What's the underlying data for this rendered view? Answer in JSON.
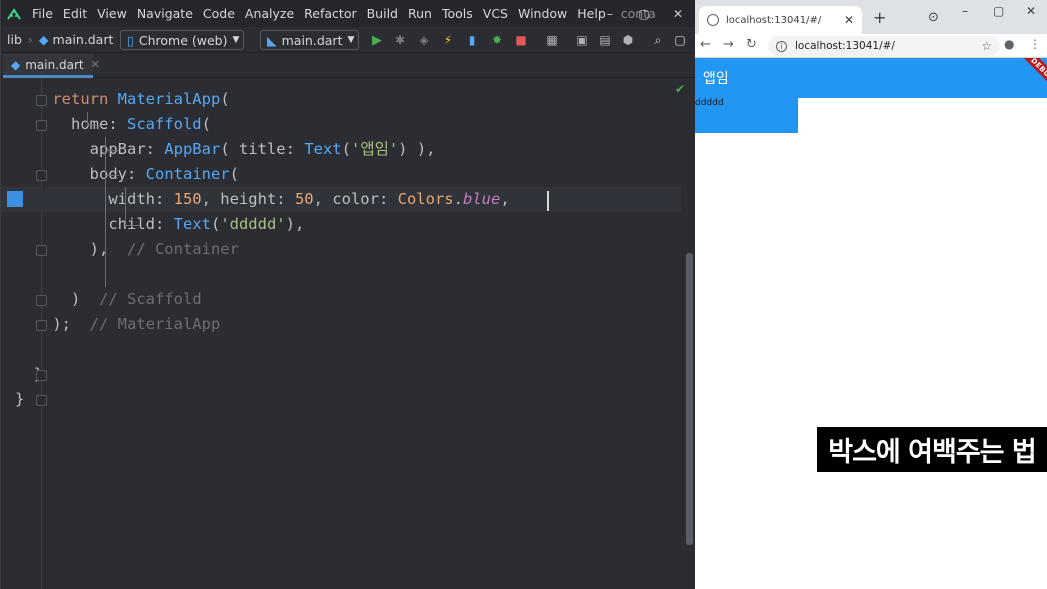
{
  "ide": {
    "menu": [
      "File",
      "Edit",
      "View",
      "Navigate",
      "Code",
      "Analyze",
      "Refactor",
      "Build",
      "Run",
      "Tools",
      "VCS",
      "Window",
      "Help"
    ],
    "project_name": "contact",
    "window_controls": [
      "–",
      "▢",
      "✕"
    ],
    "toolbar": {
      "crumb_lib": "lib",
      "crumb_file": "main.dart",
      "device": "Chrome (web)",
      "run_config": "main.dart"
    },
    "tab": {
      "label": "main.dart"
    },
    "check_mark": "✔"
  },
  "code": {
    "lines": [
      [
        {
          "t": "    "
        },
        {
          "t": "return ",
          "c": "kw"
        },
        {
          "t": "MaterialApp",
          "c": "cls"
        },
        {
          "t": "("
        }
      ],
      [
        {
          "t": "      home: "
        },
        {
          "t": "Scaffold",
          "c": "cls"
        },
        {
          "t": "("
        }
      ],
      [
        {
          "t": "        appBar: "
        },
        {
          "t": "AppBar",
          "c": "cls"
        },
        {
          "t": "( title: "
        },
        {
          "t": "Text",
          "c": "cls"
        },
        {
          "t": "("
        },
        {
          "t": "'앱임'",
          "c": "str"
        },
        {
          "t": ") ),"
        }
      ],
      [
        {
          "t": "        body: "
        },
        {
          "t": "Container",
          "c": "cls"
        },
        {
          "t": "("
        }
      ],
      [
        {
          "t": "          width: "
        },
        {
          "t": "150",
          "c": "num2"
        },
        {
          "t": ", height: "
        },
        {
          "t": "50",
          "c": "num2"
        },
        {
          "t": ", color: "
        },
        {
          "t": "Colors",
          "c": "num2"
        },
        {
          "t": "."
        },
        {
          "t": "blue",
          "c": "const"
        },
        {
          "t": ","
        }
      ],
      [
        {
          "t": "          child: "
        },
        {
          "t": "Text",
          "c": "cls"
        },
        {
          "t": "("
        },
        {
          "t": "'ddddd'",
          "c": "str"
        },
        {
          "t": "),"
        }
      ],
      [
        {
          "t": "        ),  "
        },
        {
          "t": "// Container",
          "c": "cm"
        }
      ],
      [
        {
          "t": ""
        }
      ],
      [
        {
          "t": "      )  "
        },
        {
          "t": "// Scaffold",
          "c": "cm"
        }
      ],
      [
        {
          "t": "    );  "
        },
        {
          "t": "// MaterialApp",
          "c": "cm"
        }
      ],
      [
        {
          "t": ""
        }
      ],
      [
        {
          "t": "  }"
        }
      ],
      [
        {
          "t": "}"
        }
      ]
    ],
    "current_line": 4
  },
  "browser": {
    "tab_title": "localhost:13041/#/",
    "url": "localhost:13041/#/",
    "app_title": "앱임",
    "debug_label": "DEBUG",
    "box_text": "ddddd"
  },
  "caption": "박스에 여백주는 법",
  "colors": {
    "ide_bg": "#2b2d33",
    "flutter_blue": "#2196f3",
    "debug_red": "#b71c1c"
  }
}
